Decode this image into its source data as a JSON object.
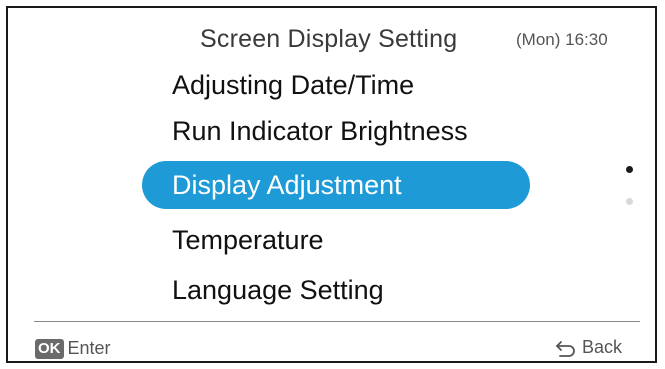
{
  "header": {
    "title": "Screen Display Setting",
    "clock": "(Mon) 16:30"
  },
  "menu": {
    "items": [
      {
        "label": "Adjusting Date/Time",
        "selected": false
      },
      {
        "label": "Run Indicator Brightness",
        "selected": false
      },
      {
        "label": "Display Adjustment",
        "selected": true
      },
      {
        "label": "Temperature",
        "selected": false
      },
      {
        "label": "Language Setting",
        "selected": false
      }
    ]
  },
  "pager": {
    "pages": 2,
    "current": 1
  },
  "footer": {
    "ok_badge": "OK",
    "enter_label": "Enter",
    "back_label": "Back",
    "back_icon": "back-arrow-icon"
  },
  "colors": {
    "accent": "#1e9bd7",
    "text": "#111111",
    "muted": "#555555"
  }
}
